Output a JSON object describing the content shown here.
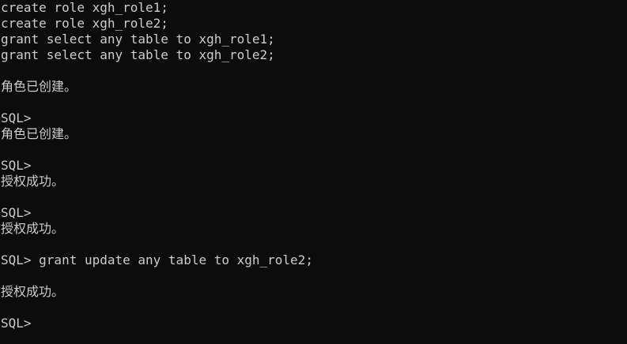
{
  "console": {
    "lines": [
      "create role xgh_role1;",
      "create role xgh_role2;",
      "grant select any table to xgh_role1;",
      "grant select any table to xgh_role2;",
      "",
      "角色已创建。",
      "",
      "SQL>",
      "角色已创建。",
      "",
      "SQL>",
      "授权成功。",
      "",
      "SQL>",
      "授权成功。",
      "",
      "SQL> grant update any table to xgh_role2;",
      "",
      "授权成功。",
      "",
      "SQL>"
    ]
  }
}
